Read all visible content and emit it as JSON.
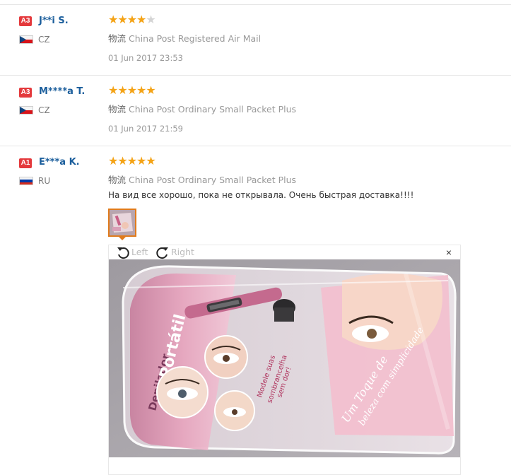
{
  "reviews": [
    {
      "badge": "A3",
      "name": "J**i S.",
      "country": "CZ",
      "flag": "cz",
      "rating": 4,
      "shipping_label": "物流",
      "shipping": "China Post Registered Air Mail",
      "date": "01 Jun 2017 23:53"
    },
    {
      "badge": "A3",
      "name": "M****a T.",
      "country": "CZ",
      "flag": "cz",
      "rating": 5,
      "shipping_label": "物流",
      "shipping": "China Post Ordinary Small Packet Plus",
      "date": "01 Jun 2017 21:59"
    },
    {
      "badge": "A1",
      "name": "E***a K.",
      "country": "RU",
      "flag": "ru",
      "rating": 5,
      "shipping_label": "物流",
      "shipping": "China Post Ordinary Small Packet Plus",
      "comment": "На вид все хорошо, пока не открывала. Очень быстрая доставка!!!!"
    }
  ],
  "viewer": {
    "rotate_left": "Left",
    "rotate_right": "Right",
    "close": "×"
  },
  "photo_text": {
    "title_1": "Depilador",
    "title_2": "Portátil",
    "tagline_1": "Um Toque de",
    "tagline_2": "beleza com simplicidade",
    "bubble_1": "Modele suas",
    "bubble_2": "sombrancelha",
    "bubble_3": "sem dor!"
  },
  "colors": {
    "badge": "#e4393c",
    "name": "#1b5e9c",
    "star_on": "#f4a316",
    "star_off": "#d4d4d4",
    "thumb_border": "#e07b1c"
  }
}
